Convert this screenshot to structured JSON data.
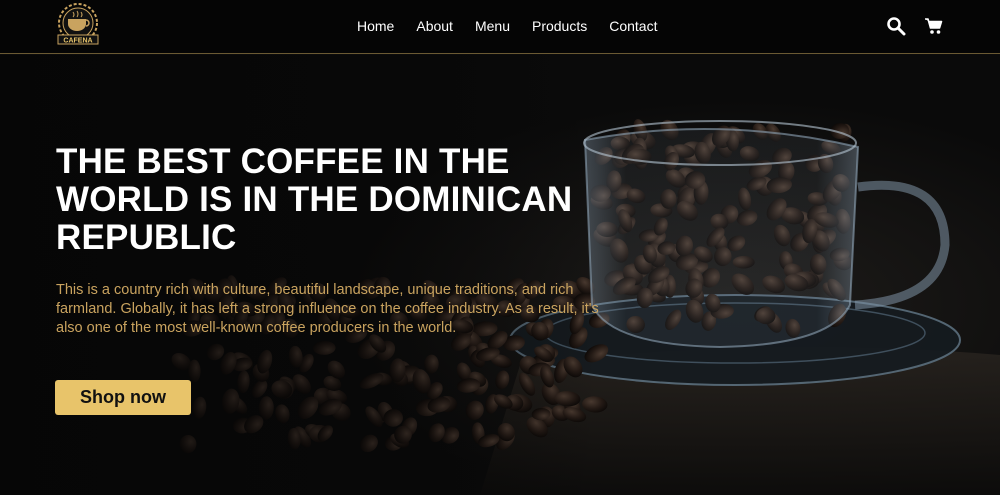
{
  "brand": {
    "logo_text": "CAFENA",
    "logo_icon": "coffee-cup-icon"
  },
  "nav": {
    "links": [
      "Home",
      "About",
      "Menu",
      "Products",
      "Contact"
    ],
    "icons": [
      "search-icon",
      "cart-icon"
    ]
  },
  "hero": {
    "title": "THE BEST COFFEE IN THE WORLD IS IN THE DOMINICAN REPUBLIC",
    "description": "This is a country rich with culture, beautiful landscape, unique traditions, and rich farmland. Globally, it has left a strong influence on the coffee industry. As a result, it's also one of the most well-known coffee producers in the world.",
    "button_label": "Shop now"
  },
  "colors": {
    "accent": "#e8c46a",
    "text_gold": "#c9a35f",
    "background": "#0b0b0b",
    "nav_border": "#6b5a33"
  }
}
